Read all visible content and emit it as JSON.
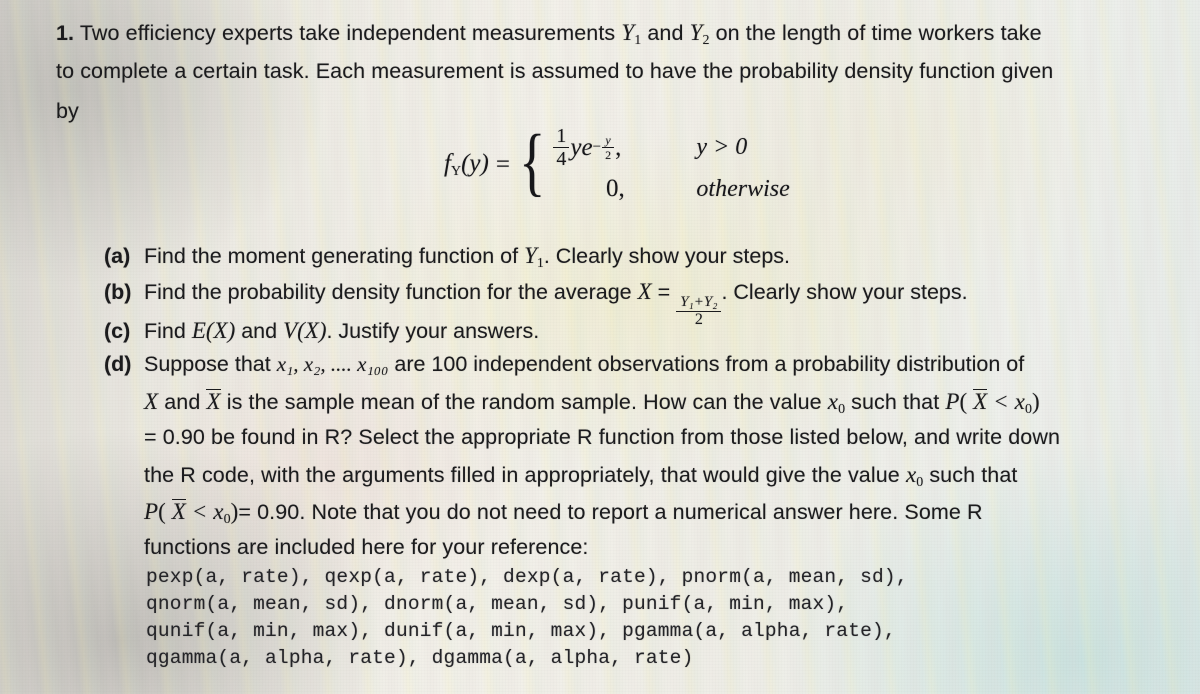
{
  "document": {
    "type": "exam-question-photo",
    "question_number": "1.",
    "intro_lines": [
      "Two efficiency experts take independent measurements  Y₁ and Y₂ on the length of time workers take",
      "to complete a certain task. Each measurement is assumed to have the probability density function given",
      "by"
    ],
    "intro_segments": {
      "line1_a": "Two efficiency experts take independent measurements",
      "line1_y1": "Y",
      "line1_y1_sub": "1",
      "line1_and": "and",
      "line1_y2": "Y",
      "line1_y2_sub": "2",
      "line1_b": "on the length of time workers take",
      "line2": "to complete a certain task. Each measurement is assumed to have the probability density function given",
      "line3": "by"
    }
  },
  "formula": {
    "lhs_f": "f",
    "lhs_sub": "Y",
    "lhs_arg": "(y)",
    "equals": "=",
    "case1_coeff_num": "1",
    "case1_coeff_den": "4",
    "case1_expr": "ye",
    "case1_exp_minus": "−",
    "case1_exp_num": "y",
    "case1_exp_den": "2",
    "case1_comma": ",",
    "case1_condition": "y > 0",
    "case2_value": "0,",
    "case2_condition": "otherwise"
  },
  "items": [
    {
      "tag": "(a)",
      "text_before": "Find the moment generating function of ",
      "var": "Y",
      "var_sub": "1",
      "text_after": ". Clearly show your steps."
    },
    {
      "tag": "(b)",
      "text_before": "Find the probability density function for the average ",
      "var": "X",
      "equals": "=",
      "frac_num": "Y₁+Y₂",
      "frac_den": "2",
      "text_after": ". Clearly show your steps."
    },
    {
      "tag": "(c)",
      "text_before": "Find ",
      "e_of_x": "E(X)",
      "mid": " and ",
      "v_of_x": "V(X)",
      "text_after": ". Justify your answers."
    }
  ],
  "item_d": {
    "tag": "(d)",
    "line1_a": "Suppose that ",
    "line1_vars": "x₁, x₂, .... x₁₀₀",
    "line1_b": " are 100 independent observations from a probability distribution of",
    "line2_a": "X",
    "line2_and": " and ",
    "line2_xbar": "X",
    "line2_b": " is the sample mean of the random sample. How can the value ",
    "line2_x0": "x₀",
    "line2_c": " such that ",
    "line2_prob": "P( X < x₀ )",
    "line3": "= 0.90 be found in R? Select the appropriate R function from those listed below, and write down",
    "line4": "the R code, with the arguments filled in appropriately, that would give the value x₀ such that",
    "line4_a": "the R code, with the arguments filled in appropriately, that would give the value ",
    "line4_x0": "x₀",
    "line4_b": " such that",
    "line5_prob": "P( X < x₀ )",
    "line5_rest": "= 0.90. Note that you do not need to report a numerical answer here. Some R",
    "line6": "functions are included here for your reference:"
  },
  "r_functions": {
    "lines": [
      "pexp(a, rate), qexp(a, rate), dexp(a, rate), pnorm(a, mean, sd),",
      "qnorm(a, mean, sd), dnorm(a, mean, sd), punif(a, min, max),",
      "qunif(a, min, max), dunif(a, min, max), pgamma(a, alpha, rate),",
      "qgamma(a, alpha, rate), dgamma(a, alpha, rate)"
    ],
    "names": [
      "pexp",
      "qexp",
      "dexp",
      "pnorm",
      "qnorm",
      "dnorm",
      "punif",
      "qunif",
      "dunif",
      "pgamma",
      "qgamma",
      "dgamma"
    ]
  },
  "colors": {
    "ink": "#1b1b1d",
    "mono_ink": "#242428",
    "paper_light": "#f3f1ea",
    "paper_shadow": "#d6d4cf",
    "tint_green": "#c4e0de",
    "tint_yellow": "#f0ecc4"
  }
}
